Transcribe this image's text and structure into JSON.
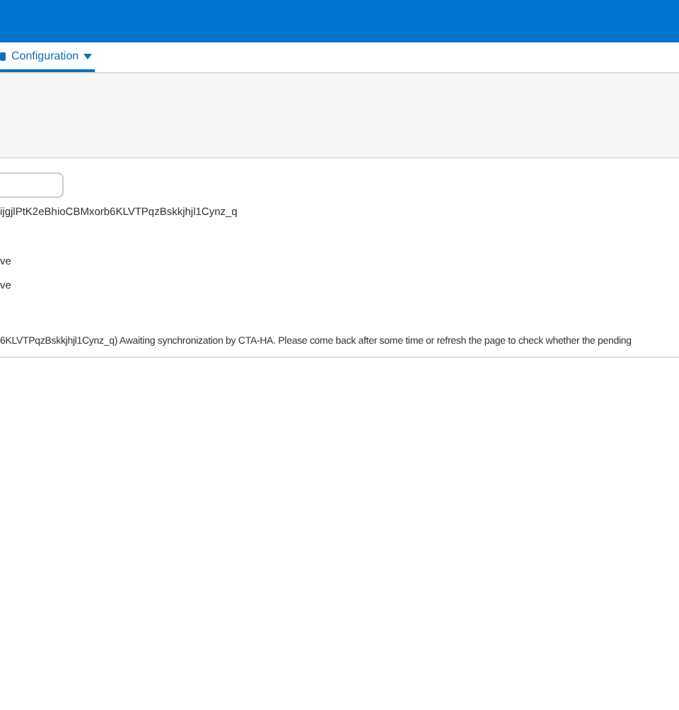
{
  "nav": {
    "tabs": [
      {
        "label": "Configuration",
        "selected": true
      }
    ]
  },
  "content": {
    "token_line": "ijgjlPtK2eBhioCBMxorb6KLVTPqzBskkjhjl1Cynz_q",
    "lines": [
      "ve",
      "ve"
    ],
    "message": "6KLVTPqzBskkjhjl1Cynz_q) Awaiting synchronization by CTA-HA. Please come back after some time or refresh the page to check whether the pending"
  }
}
